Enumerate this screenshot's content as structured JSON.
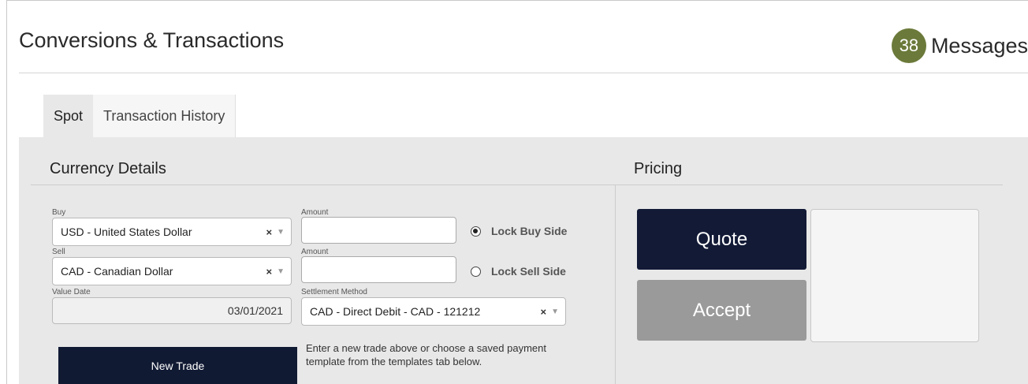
{
  "header": {
    "title": "Conversions & Transactions",
    "messages_count": "38",
    "messages_label": "Messages",
    "badge_color": "#6b7a3a"
  },
  "tabs": [
    {
      "label": "Spot",
      "active": true
    },
    {
      "label": "Transaction History",
      "active": false
    }
  ],
  "currency_details": {
    "title": "Currency Details",
    "buy": {
      "label": "Buy",
      "value": "USD - United States Dollar"
    },
    "buy_amount": {
      "label": "Amount",
      "value": ""
    },
    "sell": {
      "label": "Sell",
      "value": "CAD - Canadian Dollar"
    },
    "sell_amount": {
      "label": "Amount",
      "value": ""
    },
    "lock_buy": {
      "label": "Lock Buy Side",
      "checked": true
    },
    "lock_sell": {
      "label": "Lock Sell Side",
      "checked": false
    },
    "value_date": {
      "label": "Value Date",
      "value": "03/01/2021"
    },
    "settlement": {
      "label": "Settlement Method",
      "value": "CAD - Direct Debit - CAD - 121212"
    },
    "clear_glyph": "×",
    "arrow_glyph": "▼",
    "new_trade_label": "New Trade",
    "hint": "Enter a new trade above or choose a saved payment template from the templates tab below."
  },
  "pricing": {
    "title": "Pricing",
    "quote_label": "Quote",
    "accept_label": "Accept",
    "quote_color": "#121a36",
    "accept_color": "#9a9a9a"
  }
}
